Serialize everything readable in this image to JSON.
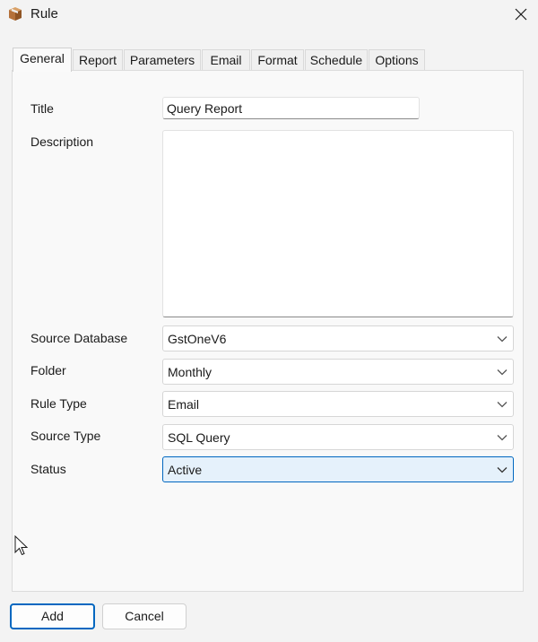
{
  "window": {
    "title": "Rule",
    "icon": "package-icon"
  },
  "tabs": [
    {
      "label": "General",
      "active": true
    },
    {
      "label": "Report",
      "active": false
    },
    {
      "label": "Parameters",
      "active": false
    },
    {
      "label": "Email",
      "active": false
    },
    {
      "label": "Format",
      "active": false
    },
    {
      "label": "Schedule",
      "active": false
    },
    {
      "label": "Options",
      "active": false
    }
  ],
  "form": {
    "title": {
      "label": "Title",
      "value": "Query Report"
    },
    "description": {
      "label": "Description",
      "value": ""
    },
    "source_database": {
      "label": "Source Database",
      "value": "GstOneV6"
    },
    "folder": {
      "label": "Folder",
      "value": "Monthly"
    },
    "rule_type": {
      "label": "Rule Type",
      "value": "Email"
    },
    "source_type": {
      "label": "Source Type",
      "value": "SQL Query"
    },
    "status": {
      "label": "Status",
      "value": "Active"
    }
  },
  "buttons": {
    "add": "Add",
    "cancel": "Cancel"
  },
  "colors": {
    "accent": "#0067c0",
    "focused_combo_bg": "#e5f1fb",
    "window_bg": "#f3f3f3"
  }
}
